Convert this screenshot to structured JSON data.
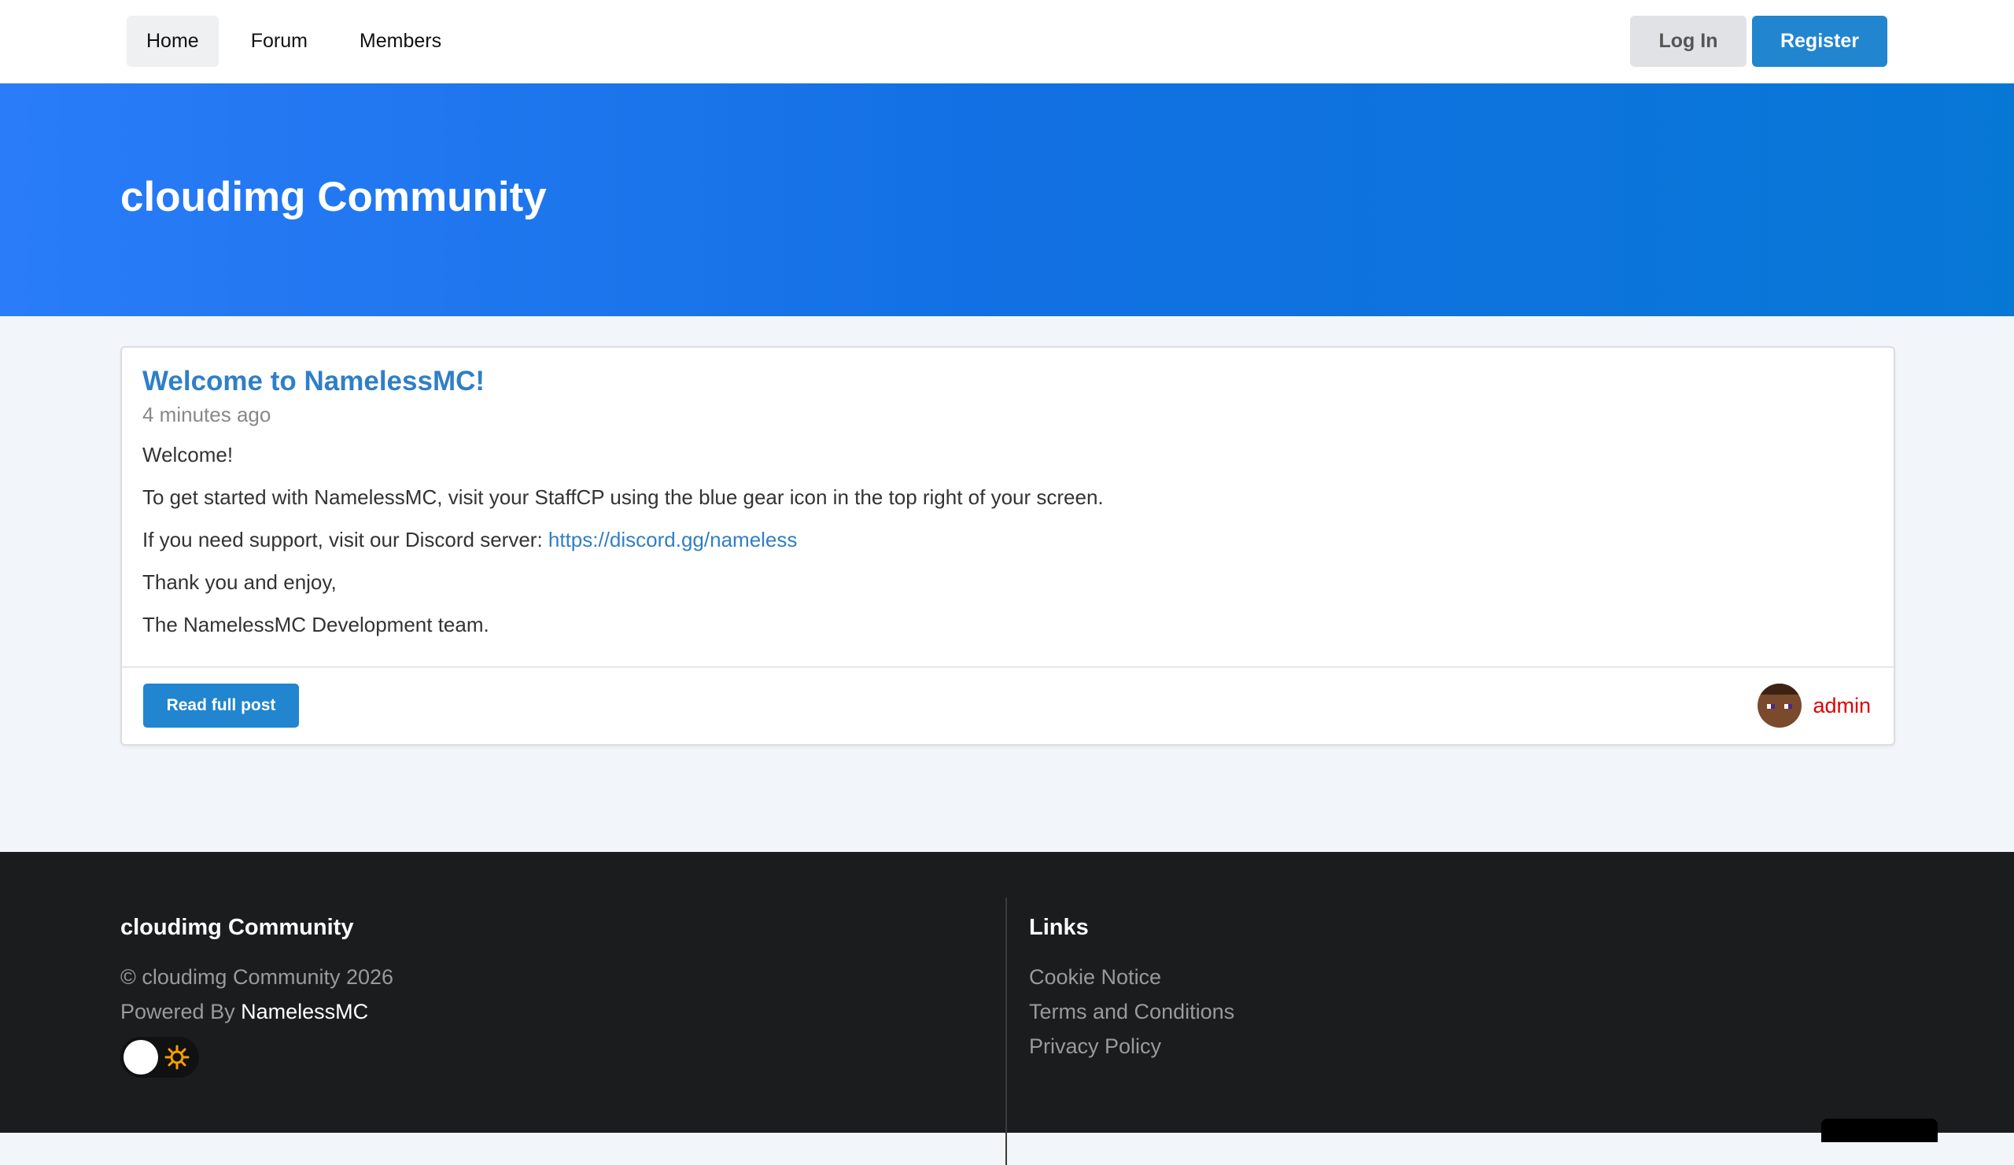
{
  "nav": {
    "items": [
      {
        "label": "Home",
        "active": true
      },
      {
        "label": "Forum",
        "active": false
      },
      {
        "label": "Members",
        "active": false
      }
    ],
    "login_label": "Log In",
    "register_label": "Register"
  },
  "hero": {
    "title": "cloudimg Community"
  },
  "post": {
    "title": "Welcome to NamelessMC!",
    "time": "4 minutes ago",
    "lines": {
      "l1": "Welcome!",
      "l2": "To get started with NamelessMC, visit your StaffCP using the blue gear icon in the top right of your screen.",
      "l3_prefix": "If you need support, visit our Discord server: ",
      "l3_link": "https://discord.gg/nameless",
      "l4": "Thank you and enjoy,",
      "l5": "The NamelessMC Development team."
    },
    "read_more_label": "Read full post",
    "author": "admin",
    "author_color": "#e00000"
  },
  "footer": {
    "site_name": "cloudimg Community",
    "copyright": "© cloudimg Community 2026",
    "powered_by_prefix": "Powered By ",
    "powered_by_brand": "NamelessMC",
    "links_heading": "Links",
    "links": [
      "Cookie Notice",
      "Terms and Conditions",
      "Privacy Policy"
    ],
    "theme_toggle_icon": "sun-icon"
  },
  "colors": {
    "accent": "#2185d0",
    "link": "#2f7fc7",
    "hero_start": "#2a7cf8",
    "hero_end": "#0777d6",
    "footer_bg": "#1b1c1d"
  }
}
